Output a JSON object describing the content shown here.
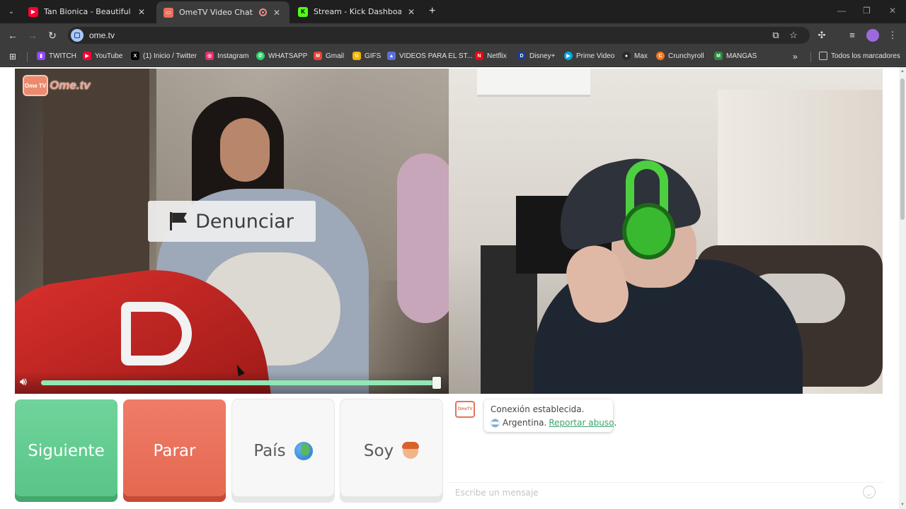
{
  "browser": {
    "tabs": [
      {
        "title": "Tan Bionica - Beautiful - YouTube",
        "favicon": "youtube-favicon",
        "color": "#ff0033"
      },
      {
        "title": "OmeTV Video Chat — Ome",
        "favicon": "ometv-favicon",
        "color": "#e8715a",
        "active": true
      },
      {
        "title": "Stream - Kick Dashboard",
        "favicon": "kick-favicon",
        "color": "#53fc18"
      }
    ],
    "new_tab": "+",
    "url": "ome.tv",
    "bookmarks": [
      {
        "label": "TWITCH",
        "icon": "twitch-icon",
        "color": "#9146ff"
      },
      {
        "label": "YouTube",
        "icon": "youtube-icon",
        "color": "#ff0033"
      },
      {
        "label": "(1) Inicio / Twitter",
        "icon": "x-icon",
        "color": "#000000"
      },
      {
        "label": "Instagram",
        "icon": "instagram-icon",
        "color": "#e1306c"
      },
      {
        "label": "WHATSAPP",
        "icon": "whatsapp-icon",
        "color": "#25d366"
      },
      {
        "label": "Gmail",
        "icon": "gmail-icon",
        "color": "#ea4335"
      },
      {
        "label": "GIFS",
        "icon": "gifs-icon",
        "color": "#f5b400"
      },
      {
        "label": "VIDEOS PARA EL ST...",
        "icon": "folder-icon",
        "color": "#5b6ee1"
      },
      {
        "label": "Netflix",
        "icon": "netflix-icon",
        "color": "#e50914"
      },
      {
        "label": "Disney+",
        "icon": "disney-icon",
        "color": "#1a3c8c"
      },
      {
        "label": "Prime Video",
        "icon": "prime-icon",
        "color": "#00a8e1"
      },
      {
        "label": "Max",
        "icon": "max-icon",
        "color": "#2a2a2a"
      },
      {
        "label": "Crunchyroll",
        "icon": "crunchyroll-icon",
        "color": "#f47521"
      },
      {
        "label": "MANGAS",
        "icon": "mangas-icon",
        "color": "#2b8a3e"
      }
    ],
    "all_bookmarks": "Todos los marcadores"
  },
  "page": {
    "logo_badge": "Ome TV",
    "logo_text": "Ome.tv",
    "report_label": "Denunciar",
    "volume_percent": 100,
    "buttons": {
      "next": "Siguiente",
      "stop": "Parar",
      "country": "País",
      "gender": "Soy"
    },
    "chat": {
      "avatar": "OmeTV",
      "status": "Conexión establecida.",
      "country": "Argentina.",
      "report_link": "Reportar abuso",
      "report_suffix": ".",
      "input_placeholder": "Escribe un mensaje"
    }
  }
}
